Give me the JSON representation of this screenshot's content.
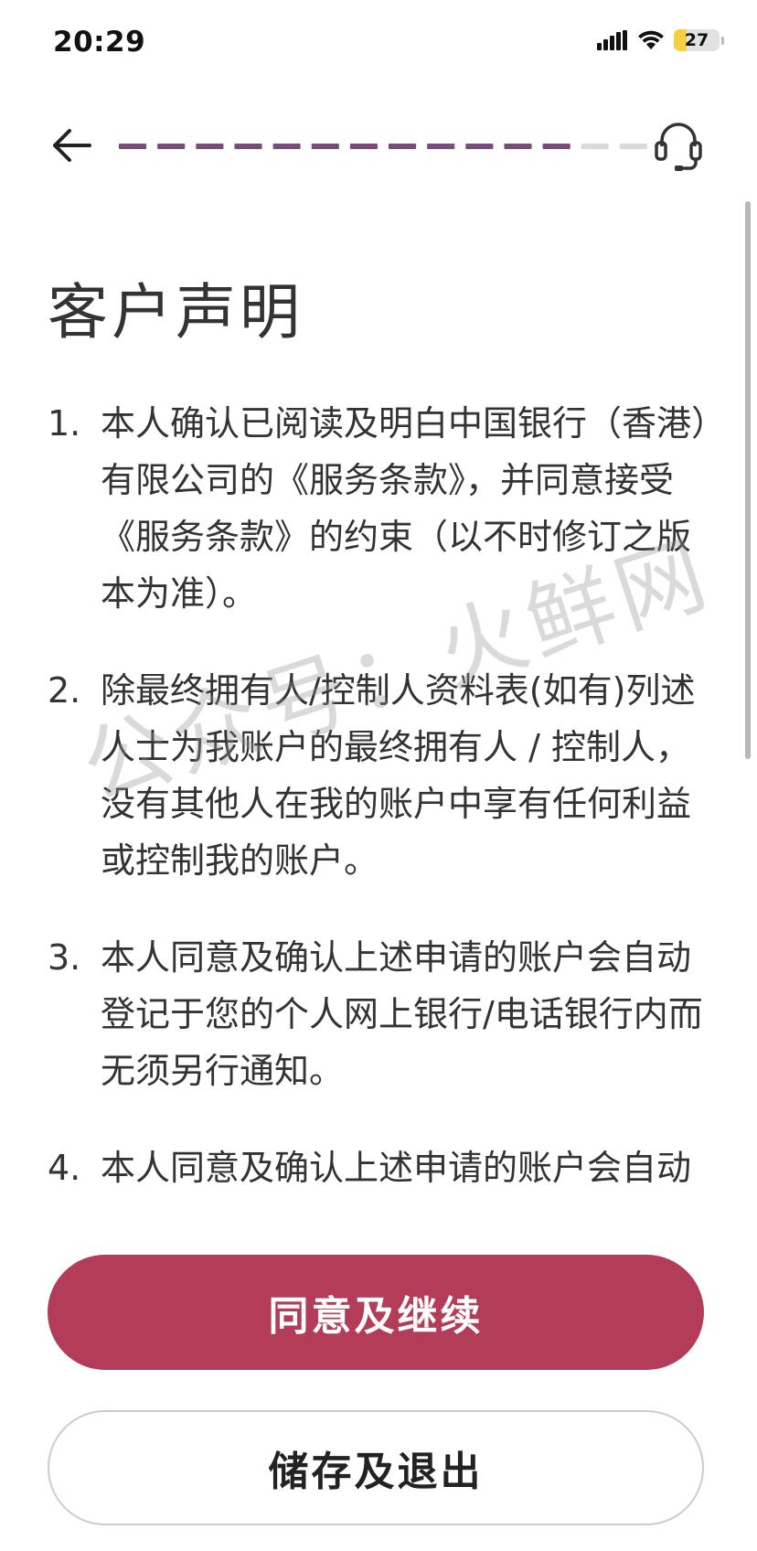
{
  "status_bar": {
    "time": "20:29",
    "battery": "27",
    "battery_level": 0.27
  },
  "nav": {
    "progress_steps_total": 14,
    "progress_steps_done": 12
  },
  "page": {
    "title": "客户声明",
    "terms": [
      {
        "num": "1.",
        "text": "本人确认已阅读及明白中国银行（香港）有限公司的《服务条款》，并同意接受《服务条款》的约束（以不时修订之版本为准）。"
      },
      {
        "num": "2.",
        "text": "除最终拥有人/控制人资料表(如有)列述人士为我账户的最终拥有人 / 控制人，没有其他人在我的账户中享有任何利益或控制我的账户。"
      },
      {
        "num": "3.",
        "text": "本人同意及确认上述申请的账户会自动登记于您的个人网上银行/电话银行内而无须另行通知。"
      },
      {
        "num": "4.",
        "text": "本人同意及确认上述申请的账户会自动登记于您的综合月结单内而无须另行通知。"
      }
    ],
    "watermark": "公众号：火鲜网"
  },
  "actions": {
    "agree_label": "同意及继续",
    "save_label": "储存及退出"
  },
  "colors": {
    "accent": "#b33d58",
    "progress_done": "#7a4a7c",
    "progress_todo": "#d9d9d9"
  }
}
